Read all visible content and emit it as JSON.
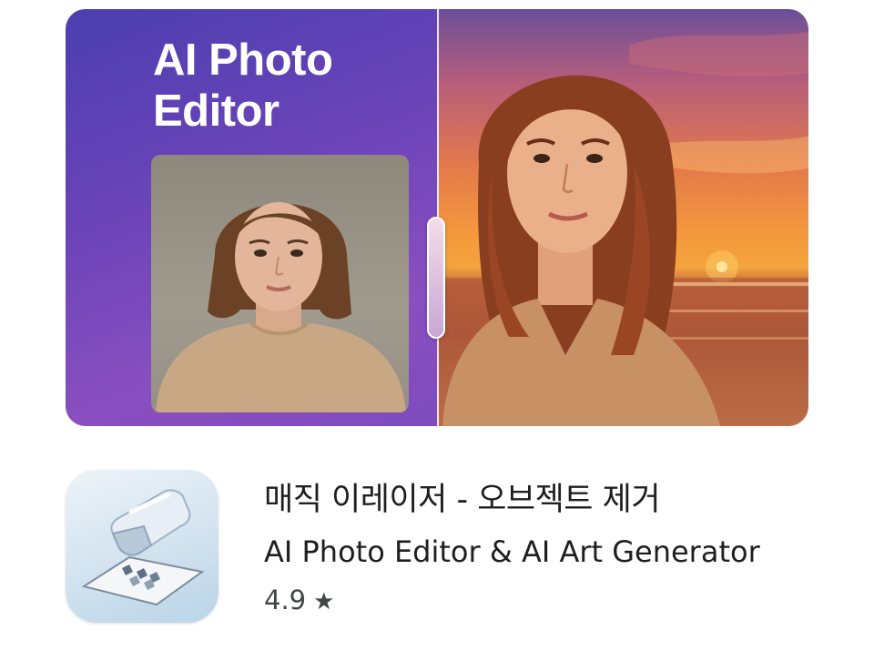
{
  "banner": {
    "title_line1": "AI Photo",
    "title_line2": "Editor",
    "accent_color": "#6a44b8"
  },
  "app": {
    "icon": "eraser-icon",
    "title": "매직 이레이저 - 오브젝트 제거",
    "subtitle": "AI Photo Editor & AI Art Generator",
    "rating": "4.9",
    "star_icon": "star-icon",
    "star_glyph": "★"
  }
}
